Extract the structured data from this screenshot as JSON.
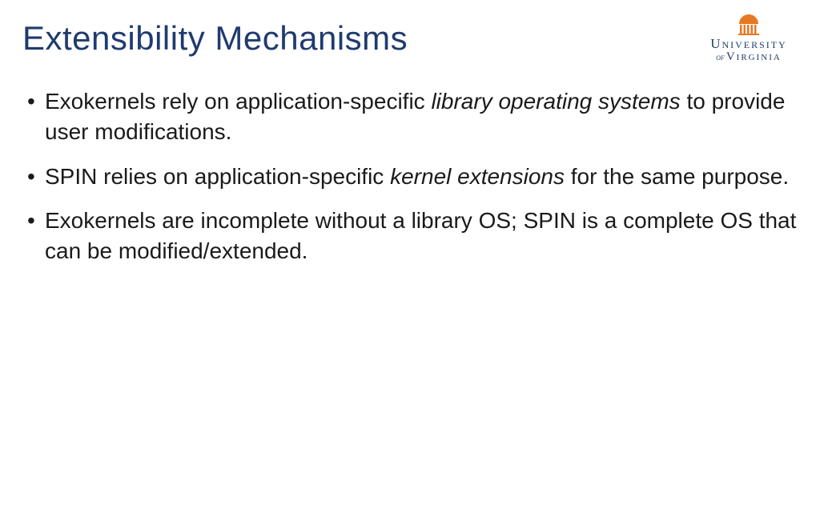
{
  "title": "Extensibility Mechanisms",
  "logo": {
    "line1": "University",
    "of": "of",
    "line2": "Virginia"
  },
  "bullets": [
    {
      "segments": [
        {
          "text": "Exokernels rely on application-specific ",
          "italic": false
        },
        {
          "text": "library operating systems",
          "italic": true
        },
        {
          "text": " to provide user modifications.",
          "italic": false
        }
      ]
    },
    {
      "segments": [
        {
          "text": "SPIN relies on application-specific ",
          "italic": false
        },
        {
          "text": "kernel extensions",
          "italic": true
        },
        {
          "text": " for the same purpose.",
          "italic": false
        }
      ]
    },
    {
      "segments": [
        {
          "text": "Exokernels are incomplete without a library OS; SPIN is a complete OS that can be modified/extended.",
          "italic": false
        }
      ]
    }
  ]
}
